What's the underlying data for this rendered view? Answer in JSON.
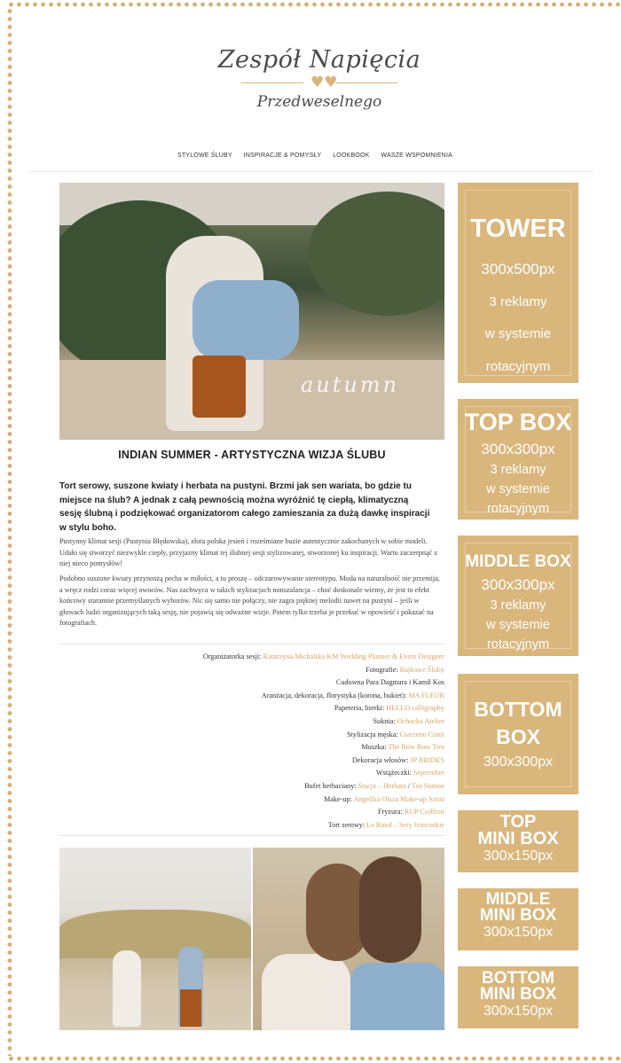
{
  "brand": {
    "logo_main": "Zespół Napięcia",
    "logo_sub": "Przedweselnego",
    "accent_color": "#d9b67c"
  },
  "nav": {
    "items": [
      {
        "label": "STYLOWE ŚLUBY"
      },
      {
        "label": "INSPIRACJE & POMYSŁY"
      },
      {
        "label": "LOOKBOOK"
      },
      {
        "label": "WASZE WSPOMNIENIA"
      }
    ]
  },
  "hero": {
    "overlay_text": "autumn"
  },
  "article": {
    "title": "INDIAN SUMMER - ARTYSTYCZNA WIZJA ŚLUBU",
    "lead": "Tort serowy, suszone kwiaty i herbata na pustyni. Brzmi jak sen wariata, bo gdzie tu miejsce na ślub? A jednak z całą pewnością można wyróżnić tę ciepłą, klimatyczną sesję ślubną i podziękować organizatorom całego zamieszania za dużą dawkę inspiracji w stylu boho.",
    "paragraph1": "Pustynny klimat sesji (Pustynia Błędowska), złota polska jesień i roześmiane buzie autentycznie zakochanych w sobie modeli. Udało się stworzyć niezwykle ciepły, przyjazny klimat tej ślubnej sesji stylizowanej, stworzonej ku inspiracji. Warto zaczerpnąć z niej nieco pomysłów!",
    "paragraph2": "Podobno suszone kwiaty przynoszą pecha w miłości, a tu proszę – odczarowywanie stereotypu. Moda na naturalność nie przemija, a wręcz rodzi coraz więcej owoców. Nas zachwyca w takich stylizacjach nonszalancja – choć doskonale wiemy, że jest to efekt końcowy starannie przemyślanych wyborów. Nic się samo nie połączy, nie zagra pięknej melodii nawet na pustyni – jeśli w głowach ludzi organizujących taką sesję, nie pojawią się odważne wizje. Potem tylko trzeba je przekuć w opowieść i pokazać na fotografiach."
  },
  "credits": [
    {
      "label": "Organizatorka sesji:",
      "link": "Katarzyna Michalska KM Wedding Planner & Event Designer"
    },
    {
      "label": "Fotografie:",
      "link": "Bajkowe Śluby"
    },
    {
      "label": "Cudowna Para Dagmara i Kamil Kos",
      "link": ""
    },
    {
      "label": "Aranżacja, dekoracja, florystyka (korona, bukiet):",
      "link": "MA FLEUR"
    },
    {
      "label": "Papeteria, literki:",
      "link": "HELLO calligraphy"
    },
    {
      "label": "Suknia:",
      "link": "Ochocka Atelier"
    },
    {
      "label": "Stylizacja męska:",
      "link": "Giacomo Conti"
    },
    {
      "label": "Muszka:",
      "link": "The Bow Bow Ties"
    },
    {
      "label": "Dekoracja włosów:",
      "link": "JP BRIDES"
    },
    {
      "label": "Wstążeczki:",
      "link": "September"
    },
    {
      "label": "Bufet herbaciany:",
      "link": "Stacja – Herbata",
      "sep": " / ",
      "link2": "Tea Station"
    },
    {
      "label": "Make-up:",
      "link": "Angelika Olsza Make-up Artist"
    },
    {
      "label": "Fryzura:",
      "link": "RUP Coiffeur"
    },
    {
      "label": "Tort serowy:",
      "link": "Le Rond – Sery francuskie"
    }
  ],
  "ads": {
    "tower": {
      "title": "TOWER",
      "size": "300x500px",
      "note1": "3 reklamy",
      "note2": "w systemie",
      "note3": "rotacyjnym"
    },
    "top_box": {
      "title": "TOP BOX",
      "size": "300x300px",
      "note1": "3 reklamy",
      "note2": "w systemie",
      "note3": "rotacyjnym"
    },
    "middle_box": {
      "title": "MIDDLE BOX",
      "size": "300x300px",
      "note1": "3 reklamy",
      "note2": "w systemie",
      "note3": "rotacyjnym"
    },
    "bottom_box": {
      "title1": "BOTTOM",
      "title2": "BOX",
      "size": "300x300px"
    },
    "top_mini": {
      "title1": "TOP",
      "title2": "MINI BOX",
      "size": "300x150px"
    },
    "middle_mini": {
      "title1": "MIDDLE",
      "title2": "MINI BOX",
      "size": "300x150px"
    },
    "bottom_mini": {
      "title1": "BOTTOM",
      "title2": "MINI BOX",
      "size": "300x150px"
    }
  }
}
